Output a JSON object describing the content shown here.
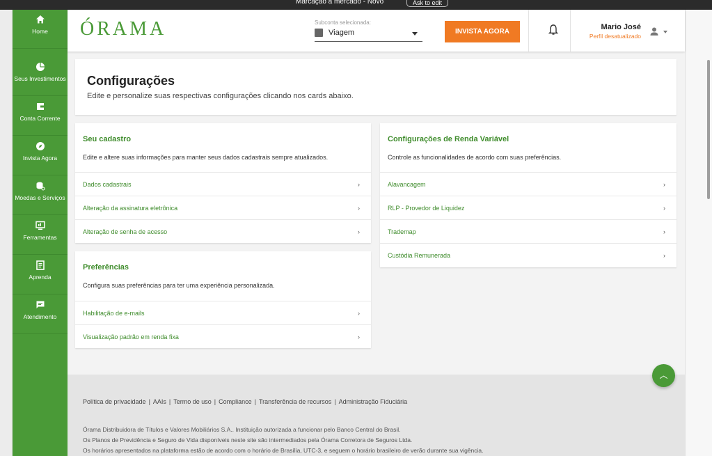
{
  "browser": {
    "title": "Marcação a mercado - Novo",
    "ask_btn": "Ask to edit"
  },
  "sidebar": {
    "items": [
      {
        "label": "Home",
        "icon": "home-icon"
      },
      {
        "label": "Seus Investimentos",
        "icon": "pie-chart-icon"
      },
      {
        "label": "Conta Corrente",
        "icon": "wallet-icon"
      },
      {
        "label": "Invista Agora",
        "icon": "compass-icon"
      },
      {
        "label": "Moedas e Serviços",
        "icon": "coins-icon"
      },
      {
        "label": "Ferramentas",
        "icon": "monitor-chart-icon"
      },
      {
        "label": "Aprenda",
        "icon": "book-icon"
      },
      {
        "label": "Atendimento",
        "icon": "chat-icon"
      }
    ]
  },
  "header": {
    "logo": "ÓRAMA",
    "subaccount_label": "Subconta selecionada:",
    "subaccount_value": "Viagem",
    "cta": "INVISTA AGORA",
    "user_name": "Mario José",
    "user_status": "Perfil desatualizado"
  },
  "page": {
    "title": "Configurações",
    "subtitle": "Edite e personalize suas respectivas configurações clicando nos cards abaixo."
  },
  "cards": {
    "cadastro": {
      "title": "Seu cadastro",
      "desc": "Edite e altere suas informações para manter seus dados cadastrais sempre atualizados.",
      "rows": [
        "Dados cadastrais",
        "Alteração da assinatura eletrônica",
        "Alteração de senha de acesso"
      ]
    },
    "preferencias": {
      "title": "Preferências",
      "desc": "Configura suas preferências para ter uma experiência personalizada.",
      "rows": [
        "Habilitação de e-mails",
        "Visualização padrão em renda fixa"
      ]
    },
    "renda": {
      "title": "Configurações de Renda Variável",
      "desc": "Controle as funcionalidades de acordo com suas preferências.",
      "rows": [
        "Alavancagem",
        "RLP - Provedor de Liquidez",
        "Trademap",
        "Custódia Remunerada"
      ]
    }
  },
  "footer": {
    "links": [
      "Política de privacidade",
      "AAIs",
      "Termo de uso",
      "Compliance",
      "Transferência de recursos",
      "Administração Fiduciária"
    ],
    "lines": [
      "Órama Distribuidora de Títulos e Valores Mobiliários S.A.. Instituição autorizada a funcionar pelo Banco Central do Brasil.",
      "Os Planos de Previdência e Seguro de Vida disponíveis neste site são intermediados pela Órama Corretora de Seguros Ltda.",
      "Os horários apresentados na plataforma estão de acordo com o horário de Brasília, UTC-3, e seguem o horário brasileiro de verão durante sua vigência."
    ]
  },
  "colors": {
    "brand_green": "#4a9a37",
    "accent_orange": "#f07a23"
  }
}
